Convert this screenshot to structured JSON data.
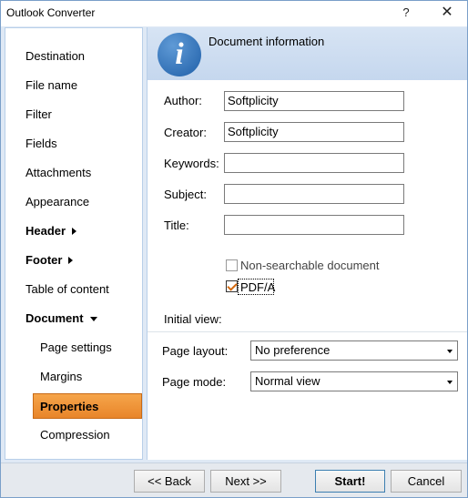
{
  "window": {
    "title": "Outlook Converter",
    "help_glyph": "?",
    "close_glyph": "✕"
  },
  "sidebar": {
    "items": [
      {
        "label": "Destination"
      },
      {
        "label": "File name"
      },
      {
        "label": "Filter"
      },
      {
        "label": "Fields"
      },
      {
        "label": "Attachments"
      },
      {
        "label": "Appearance"
      },
      {
        "label": "Header"
      },
      {
        "label": "Footer"
      },
      {
        "label": "Table of content"
      },
      {
        "label": "Document"
      },
      {
        "label": "Page settings"
      },
      {
        "label": "Margins"
      },
      {
        "label": "Properties"
      },
      {
        "label": "Compression"
      }
    ],
    "selected": "Properties"
  },
  "content": {
    "header_title": "Document information",
    "icon": "info-icon",
    "fields": {
      "author": {
        "label": "Author:",
        "value": "Softplicity"
      },
      "creator": {
        "label": "Creator:",
        "value": "Softplicity"
      },
      "keywords": {
        "label": "Keywords:",
        "value": ""
      },
      "subject": {
        "label": "Subject:",
        "value": ""
      },
      "title": {
        "label": "Title:",
        "value": ""
      }
    },
    "checkboxes": {
      "non_searchable": {
        "label": "Non-searchable document",
        "checked": false
      },
      "pdfa": {
        "label": "PDF/A",
        "checked": true
      }
    },
    "initial_view": {
      "heading": "Initial view:",
      "page_layout": {
        "label": "Page layout:",
        "value": "No preference"
      },
      "page_mode": {
        "label": "Page mode:",
        "value": "Normal view"
      }
    }
  },
  "footer": {
    "back_label": "<< Back",
    "next_label": "Next >>",
    "start_label": "Start!",
    "cancel_label": "Cancel"
  },
  "colors": {
    "selected_bg": "#f0963c",
    "accent_blue": "#1f5fa8",
    "panel_bg": "#dfe9f5"
  }
}
